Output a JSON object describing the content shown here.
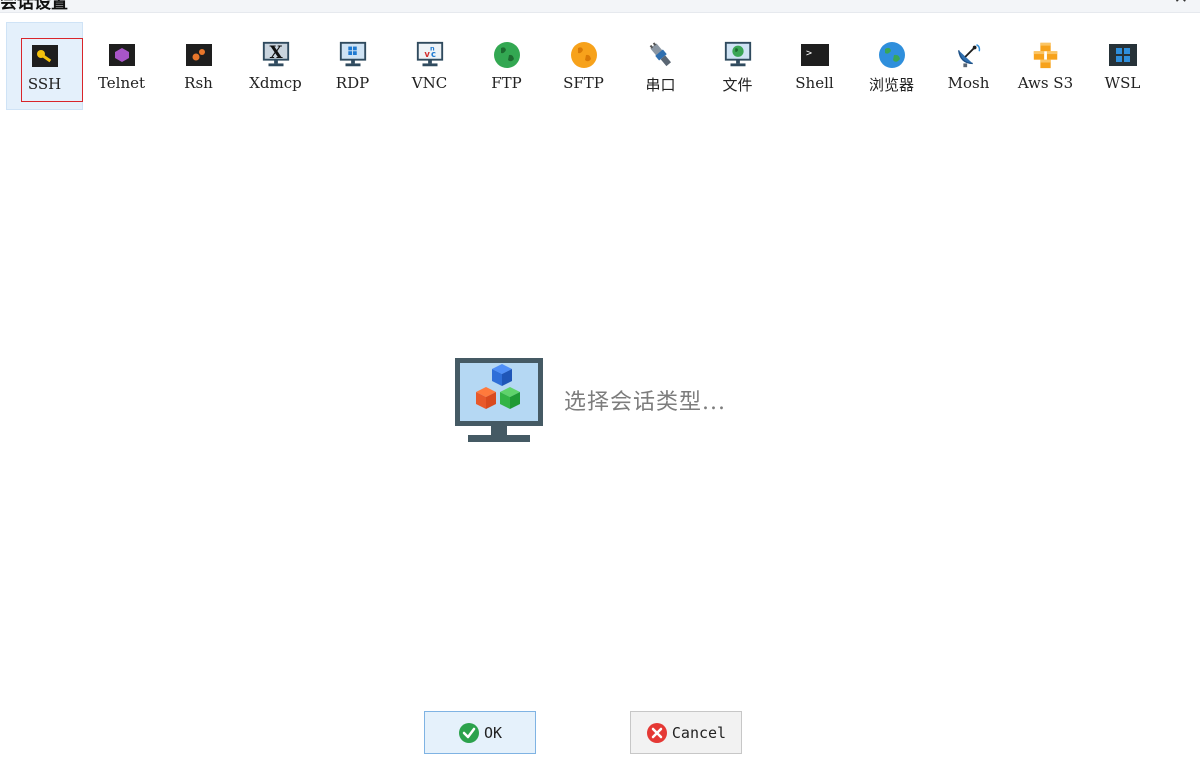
{
  "window": {
    "title": "会话设置",
    "close_glyph": "✕"
  },
  "session_types": [
    {
      "label": "SSH",
      "icon": "key-icon",
      "selected": true
    },
    {
      "label": "Telnet",
      "icon": "telnet-icon"
    },
    {
      "label": "Rsh",
      "icon": "rsh-icon"
    },
    {
      "label": "Xdmcp",
      "icon": "xdmcp-icon"
    },
    {
      "label": "RDP",
      "icon": "rdp-icon"
    },
    {
      "label": "VNC",
      "icon": "vnc-icon"
    },
    {
      "label": "FTP",
      "icon": "ftp-globe-icon"
    },
    {
      "label": "SFTP",
      "icon": "sftp-globe-icon"
    },
    {
      "label": "串口",
      "icon": "serial-plug-icon"
    },
    {
      "label": "文件",
      "icon": "file-monitor-icon"
    },
    {
      "label": "Shell",
      "icon": "shell-terminal-icon"
    },
    {
      "label": "浏览器",
      "icon": "browser-globe-icon"
    },
    {
      "label": "Mosh",
      "icon": "satellite-dish-icon"
    },
    {
      "label": "Aws S3",
      "icon": "aws-cubes-icon"
    },
    {
      "label": "WSL",
      "icon": "windows-logo-icon"
    }
  ],
  "center": {
    "prompt": "选择会话类型..."
  },
  "buttons": {
    "ok_label": "OK",
    "cancel_label": "Cancel"
  },
  "colors": {
    "selected_bg": "#e4f0fb",
    "focus_border": "#d9252a",
    "ok_green": "#2ca24c",
    "cancel_red": "#e53935"
  }
}
